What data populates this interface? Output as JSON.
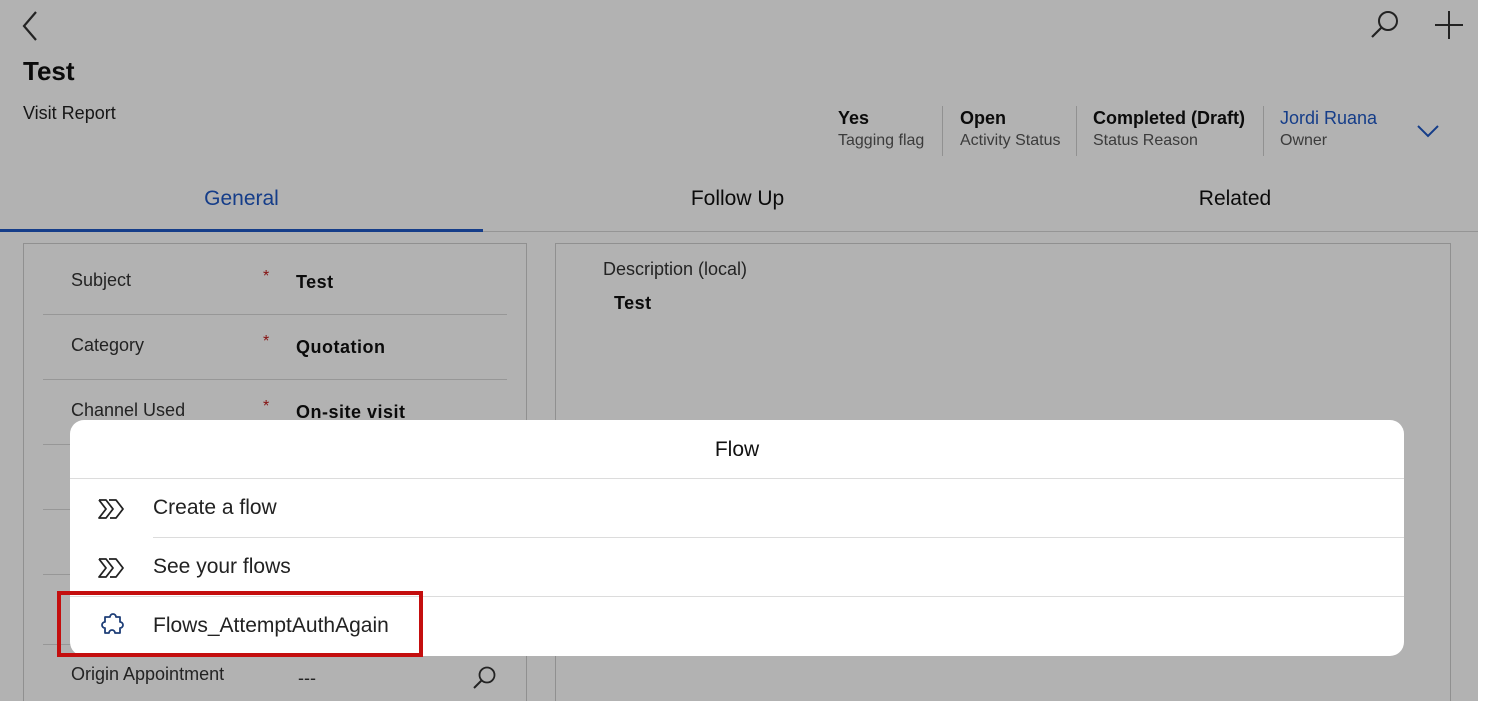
{
  "header": {
    "title": "Test",
    "entity_name": "Visit Report",
    "fields": [
      {
        "value": "Yes",
        "label": "Tagging flag"
      },
      {
        "value": "Open",
        "label": "Activity Status"
      },
      {
        "value": "Completed (Draft)",
        "label": "Status Reason"
      },
      {
        "value": "Jordi Ruana",
        "label": "Owner"
      }
    ]
  },
  "tabs": [
    {
      "label": "General",
      "active": true
    },
    {
      "label": "Follow Up",
      "active": false
    },
    {
      "label": "Related",
      "active": false
    }
  ],
  "form": {
    "required_mark": "*",
    "fields": [
      {
        "label": "Subject",
        "value": "Test"
      },
      {
        "label": "Category",
        "value": "Quotation"
      },
      {
        "label": "Channel Used",
        "value": "On-site visit"
      }
    ],
    "origin": {
      "label": "Origin Appointment",
      "value": "---"
    },
    "description": {
      "label": "Description (local)",
      "value": "Test"
    }
  },
  "flow_sheet": {
    "title": "Flow",
    "items": [
      {
        "label": "Create a flow",
        "icon": "flow-icon"
      },
      {
        "label": "See your flows",
        "icon": "flow-icon"
      },
      {
        "label": "Flows_AttemptAuthAgain",
        "icon": "puzzle-icon"
      }
    ]
  },
  "colors": {
    "accent": "#1f58c4",
    "required": "#c01a1a",
    "highlight_border": "#c40e0e",
    "dim_overlay": "rgba(0,0,0,0.30)"
  }
}
